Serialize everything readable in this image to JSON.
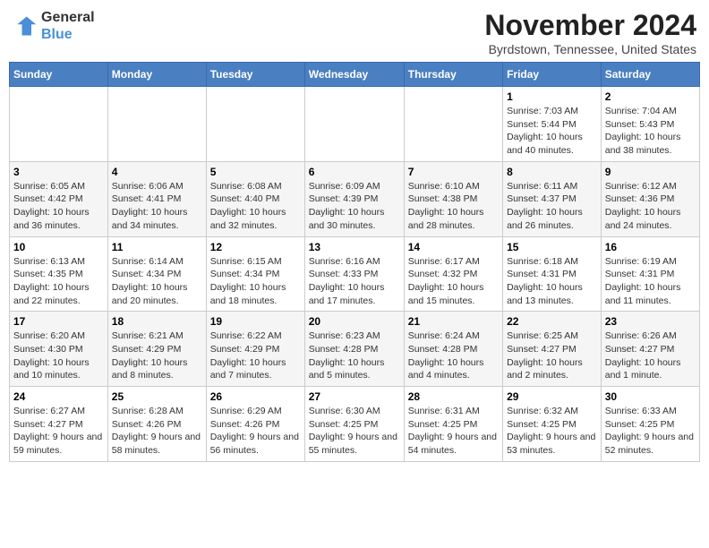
{
  "header": {
    "logo_line1": "General",
    "logo_line2": "Blue",
    "month": "November 2024",
    "location": "Byrdstown, Tennessee, United States"
  },
  "days_of_week": [
    "Sunday",
    "Monday",
    "Tuesday",
    "Wednesday",
    "Thursday",
    "Friday",
    "Saturday"
  ],
  "weeks": [
    [
      {
        "num": "",
        "info": ""
      },
      {
        "num": "",
        "info": ""
      },
      {
        "num": "",
        "info": ""
      },
      {
        "num": "",
        "info": ""
      },
      {
        "num": "",
        "info": ""
      },
      {
        "num": "1",
        "info": "Sunrise: 7:03 AM\nSunset: 5:44 PM\nDaylight: 10 hours and 40 minutes."
      },
      {
        "num": "2",
        "info": "Sunrise: 7:04 AM\nSunset: 5:43 PM\nDaylight: 10 hours and 38 minutes."
      }
    ],
    [
      {
        "num": "3",
        "info": "Sunrise: 6:05 AM\nSunset: 4:42 PM\nDaylight: 10 hours and 36 minutes."
      },
      {
        "num": "4",
        "info": "Sunrise: 6:06 AM\nSunset: 4:41 PM\nDaylight: 10 hours and 34 minutes."
      },
      {
        "num": "5",
        "info": "Sunrise: 6:08 AM\nSunset: 4:40 PM\nDaylight: 10 hours and 32 minutes."
      },
      {
        "num": "6",
        "info": "Sunrise: 6:09 AM\nSunset: 4:39 PM\nDaylight: 10 hours and 30 minutes."
      },
      {
        "num": "7",
        "info": "Sunrise: 6:10 AM\nSunset: 4:38 PM\nDaylight: 10 hours and 28 minutes."
      },
      {
        "num": "8",
        "info": "Sunrise: 6:11 AM\nSunset: 4:37 PM\nDaylight: 10 hours and 26 minutes."
      },
      {
        "num": "9",
        "info": "Sunrise: 6:12 AM\nSunset: 4:36 PM\nDaylight: 10 hours and 24 minutes."
      }
    ],
    [
      {
        "num": "10",
        "info": "Sunrise: 6:13 AM\nSunset: 4:35 PM\nDaylight: 10 hours and 22 minutes."
      },
      {
        "num": "11",
        "info": "Sunrise: 6:14 AM\nSunset: 4:34 PM\nDaylight: 10 hours and 20 minutes."
      },
      {
        "num": "12",
        "info": "Sunrise: 6:15 AM\nSunset: 4:34 PM\nDaylight: 10 hours and 18 minutes."
      },
      {
        "num": "13",
        "info": "Sunrise: 6:16 AM\nSunset: 4:33 PM\nDaylight: 10 hours and 17 minutes."
      },
      {
        "num": "14",
        "info": "Sunrise: 6:17 AM\nSunset: 4:32 PM\nDaylight: 10 hours and 15 minutes."
      },
      {
        "num": "15",
        "info": "Sunrise: 6:18 AM\nSunset: 4:31 PM\nDaylight: 10 hours and 13 minutes."
      },
      {
        "num": "16",
        "info": "Sunrise: 6:19 AM\nSunset: 4:31 PM\nDaylight: 10 hours and 11 minutes."
      }
    ],
    [
      {
        "num": "17",
        "info": "Sunrise: 6:20 AM\nSunset: 4:30 PM\nDaylight: 10 hours and 10 minutes."
      },
      {
        "num": "18",
        "info": "Sunrise: 6:21 AM\nSunset: 4:29 PM\nDaylight: 10 hours and 8 minutes."
      },
      {
        "num": "19",
        "info": "Sunrise: 6:22 AM\nSunset: 4:29 PM\nDaylight: 10 hours and 7 minutes."
      },
      {
        "num": "20",
        "info": "Sunrise: 6:23 AM\nSunset: 4:28 PM\nDaylight: 10 hours and 5 minutes."
      },
      {
        "num": "21",
        "info": "Sunrise: 6:24 AM\nSunset: 4:28 PM\nDaylight: 10 hours and 4 minutes."
      },
      {
        "num": "22",
        "info": "Sunrise: 6:25 AM\nSunset: 4:27 PM\nDaylight: 10 hours and 2 minutes."
      },
      {
        "num": "23",
        "info": "Sunrise: 6:26 AM\nSunset: 4:27 PM\nDaylight: 10 hours and 1 minute."
      }
    ],
    [
      {
        "num": "24",
        "info": "Sunrise: 6:27 AM\nSunset: 4:27 PM\nDaylight: 9 hours and 59 minutes."
      },
      {
        "num": "25",
        "info": "Sunrise: 6:28 AM\nSunset: 4:26 PM\nDaylight: 9 hours and 58 minutes."
      },
      {
        "num": "26",
        "info": "Sunrise: 6:29 AM\nSunset: 4:26 PM\nDaylight: 9 hours and 56 minutes."
      },
      {
        "num": "27",
        "info": "Sunrise: 6:30 AM\nSunset: 4:25 PM\nDaylight: 9 hours and 55 minutes."
      },
      {
        "num": "28",
        "info": "Sunrise: 6:31 AM\nSunset: 4:25 PM\nDaylight: 9 hours and 54 minutes."
      },
      {
        "num": "29",
        "info": "Sunrise: 6:32 AM\nSunset: 4:25 PM\nDaylight: 9 hours and 53 minutes."
      },
      {
        "num": "30",
        "info": "Sunrise: 6:33 AM\nSunset: 4:25 PM\nDaylight: 9 hours and 52 minutes."
      }
    ]
  ]
}
